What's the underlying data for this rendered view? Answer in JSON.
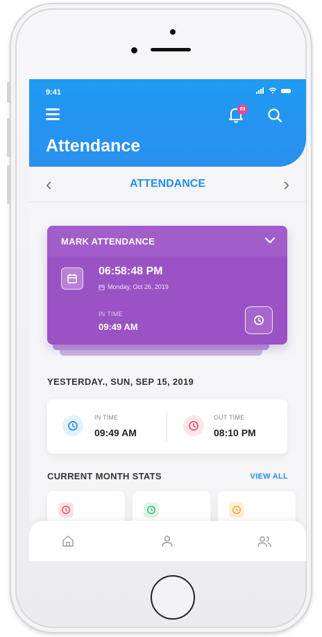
{
  "status_bar": {
    "time": "9:41"
  },
  "header": {
    "title": "Attendance",
    "notification_badge": "03",
    "accent": "#1f9bf2"
  },
  "subnav": {
    "title": "ATTENDANCE",
    "prev_icon": "chevron-left-icon",
    "next_icon": "chevron-right-icon"
  },
  "mark_attendance": {
    "title": "MARK ATTENDANCE",
    "current_time": "06:58:48 PM",
    "date": "Monday, Oct 26, 2019",
    "in_time_label": "IN TIME",
    "in_time": "09:49 AM",
    "color": "#9b52c5"
  },
  "yesterday": {
    "title": "YESTERDAY., SUN, SEP 15, 2019",
    "in_label": "IN TIME",
    "in_value": "09:49 AM",
    "out_label": "OUT TIME",
    "out_value": "08:10 PM"
  },
  "stats": {
    "title": "CURRENT MONTH STATS",
    "view_all": "VIEW ALL",
    "cards": [
      {
        "icon": "clock-icon",
        "color": "#e85b6a"
      },
      {
        "icon": "clock-icon",
        "color": "#3bbf7a"
      },
      {
        "icon": "clock-icon",
        "color": "#f2a33a"
      }
    ]
  },
  "tabbar": {
    "items": [
      "home-icon",
      "user-icon",
      "users-icon"
    ]
  }
}
